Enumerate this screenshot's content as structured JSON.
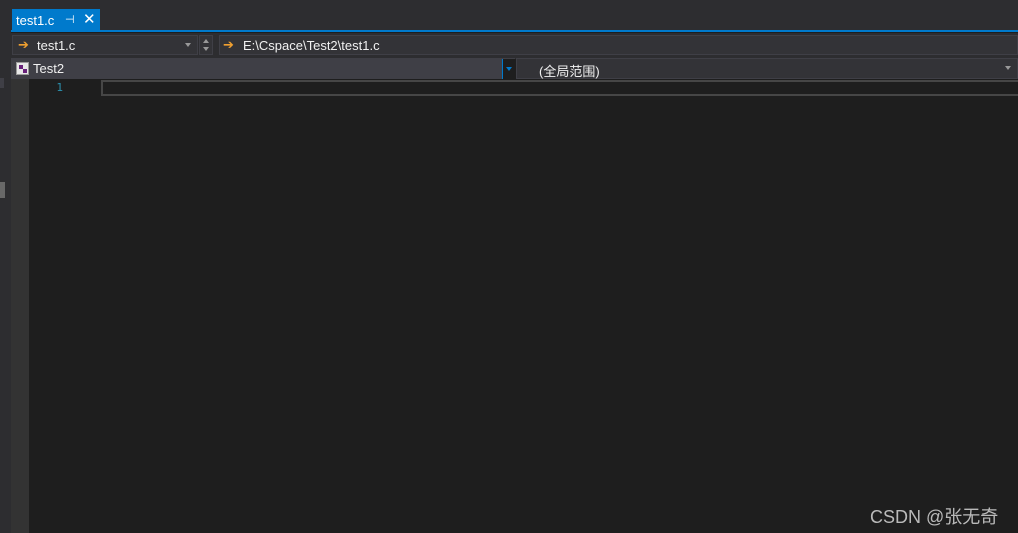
{
  "tab": {
    "label": "test1.c",
    "pin_glyph": "⊣",
    "close_glyph": "✕"
  },
  "nav": {
    "file_name": "test1.c",
    "file_path": "E:\\Cspace\\Test2\\test1.c",
    "arrow_glyph": "➔"
  },
  "scope": {
    "project": "Test2",
    "global_scope": "(全局范围)"
  },
  "editor": {
    "line_numbers": [
      "1"
    ]
  },
  "watermark": {
    "text": "CSDN @张无奇"
  },
  "colors": {
    "accent": "#007acc",
    "background": "#1e1e1e",
    "chrome": "#2d2d30",
    "line_number": "#2b91af"
  }
}
